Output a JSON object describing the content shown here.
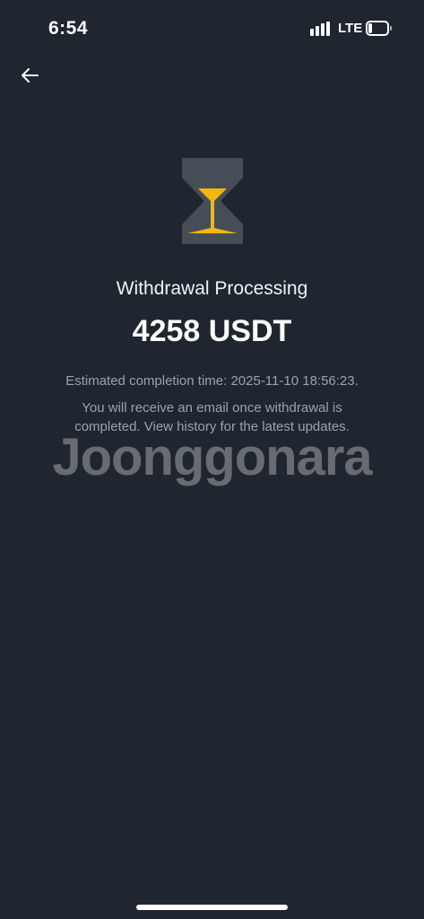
{
  "status_bar": {
    "time": "6:54",
    "network": "LTE",
    "battery_level": 0.2
  },
  "header": {
    "back_icon": "arrow-left-icon"
  },
  "status_icon": "hourglass-icon",
  "colors": {
    "background": "#1f2630",
    "accent": "#f0b90b",
    "hourglass_frame": "#474d57",
    "muted_text": "#9aa2ad"
  },
  "content": {
    "title": "Withdrawal Processing",
    "amount": "4258 USDT",
    "estimated_completion": "Estimated completion time: 2025-11-10 18:56:23.",
    "note": "You will receive an email once withdrawal is completed. View history for the latest updates."
  },
  "watermark": "Joonggonara"
}
